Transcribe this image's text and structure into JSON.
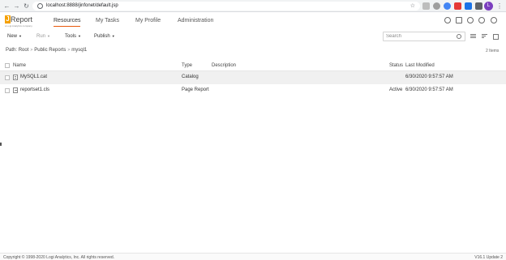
{
  "browser": {
    "url": "localhost:8888/jinfonet/default.jsp",
    "profile_initial": "L"
  },
  "app": {
    "logo_letter": "J",
    "logo_name": "Report",
    "logo_tagline": "a Logi Analytics company",
    "tabs": [
      {
        "label": "Resources",
        "active": true
      },
      {
        "label": "My Tasks",
        "active": false
      },
      {
        "label": "My Profile",
        "active": false
      },
      {
        "label": "Administration",
        "active": false
      }
    ],
    "accent_color": "#e8590c",
    "logo_color": "#f5a000"
  },
  "toolbar": {
    "new_label": "New",
    "run_label": "Run",
    "tools_label": "Tools",
    "publish_label": "Publish",
    "search_placeholder": "Search",
    "search_value": ""
  },
  "breadcrumb": {
    "prefix": "Path:",
    "items": [
      "Root",
      "Public Reports",
      "mysql1"
    ]
  },
  "item_count": "2 Items",
  "table": {
    "headers": {
      "name": "Name",
      "type": "Type",
      "description": "Description",
      "status": "Status",
      "last_modified": "Last Modified"
    },
    "rows": [
      {
        "name": "MySQL1.cat",
        "icon": "catalog-file-icon",
        "type": "Catalog",
        "description": "",
        "status": "",
        "last_modified": "6/30/2020 9:57:57 AM",
        "selected": true
      },
      {
        "name": "reportset1.cls",
        "icon": "report-file-icon",
        "type": "Page Report",
        "description": "",
        "status": "Active",
        "last_modified": "6/30/2020 9:57:57 AM",
        "selected": false
      }
    ]
  },
  "footer": {
    "copyright": "Copyright © 1998-2020 Logi Analytics, Inc. All rights reserved.",
    "version": "V16.1 Update 2"
  }
}
